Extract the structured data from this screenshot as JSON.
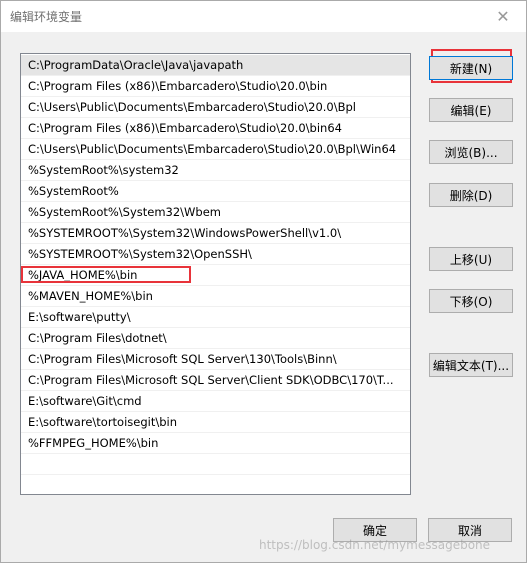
{
  "window": {
    "title": "编辑环境变量",
    "close_glyph": "✕"
  },
  "path_list": [
    "C:\\ProgramData\\Oracle\\Java\\javapath",
    "C:\\Program Files (x86)\\Embarcadero\\Studio\\20.0\\bin",
    "C:\\Users\\Public\\Documents\\Embarcadero\\Studio\\20.0\\Bpl",
    "C:\\Program Files (x86)\\Embarcadero\\Studio\\20.0\\bin64",
    "C:\\Users\\Public\\Documents\\Embarcadero\\Studio\\20.0\\Bpl\\Win64",
    "%SystemRoot%\\system32",
    "%SystemRoot%",
    "%SystemRoot%\\System32\\Wbem",
    "%SYSTEMROOT%\\System32\\WindowsPowerShell\\v1.0\\",
    "%SYSTEMROOT%\\System32\\OpenSSH\\",
    "%JAVA_HOME%\\bin",
    "%MAVEN_HOME%\\bin",
    "E:\\software\\putty\\",
    "C:\\Program Files\\dotnet\\",
    "C:\\Program Files\\Microsoft SQL Server\\130\\Tools\\Binn\\",
    "C:\\Program Files\\Microsoft SQL Server\\Client SDK\\ODBC\\170\\T...",
    "E:\\software\\Git\\cmd",
    "E:\\software\\tortoisegit\\bin",
    "%FFMPEG_HOME%\\bin"
  ],
  "buttons": {
    "new": "新建(N)",
    "edit": "编辑(E)",
    "browse": "浏览(B)...",
    "delete": "删除(D)",
    "move_up": "上移(U)",
    "move_down": "下移(O)",
    "edit_text": "编辑文本(T)...",
    "ok": "确定",
    "cancel": "取消"
  },
  "watermark": "https://blog.csdn.net/mymessagebone"
}
